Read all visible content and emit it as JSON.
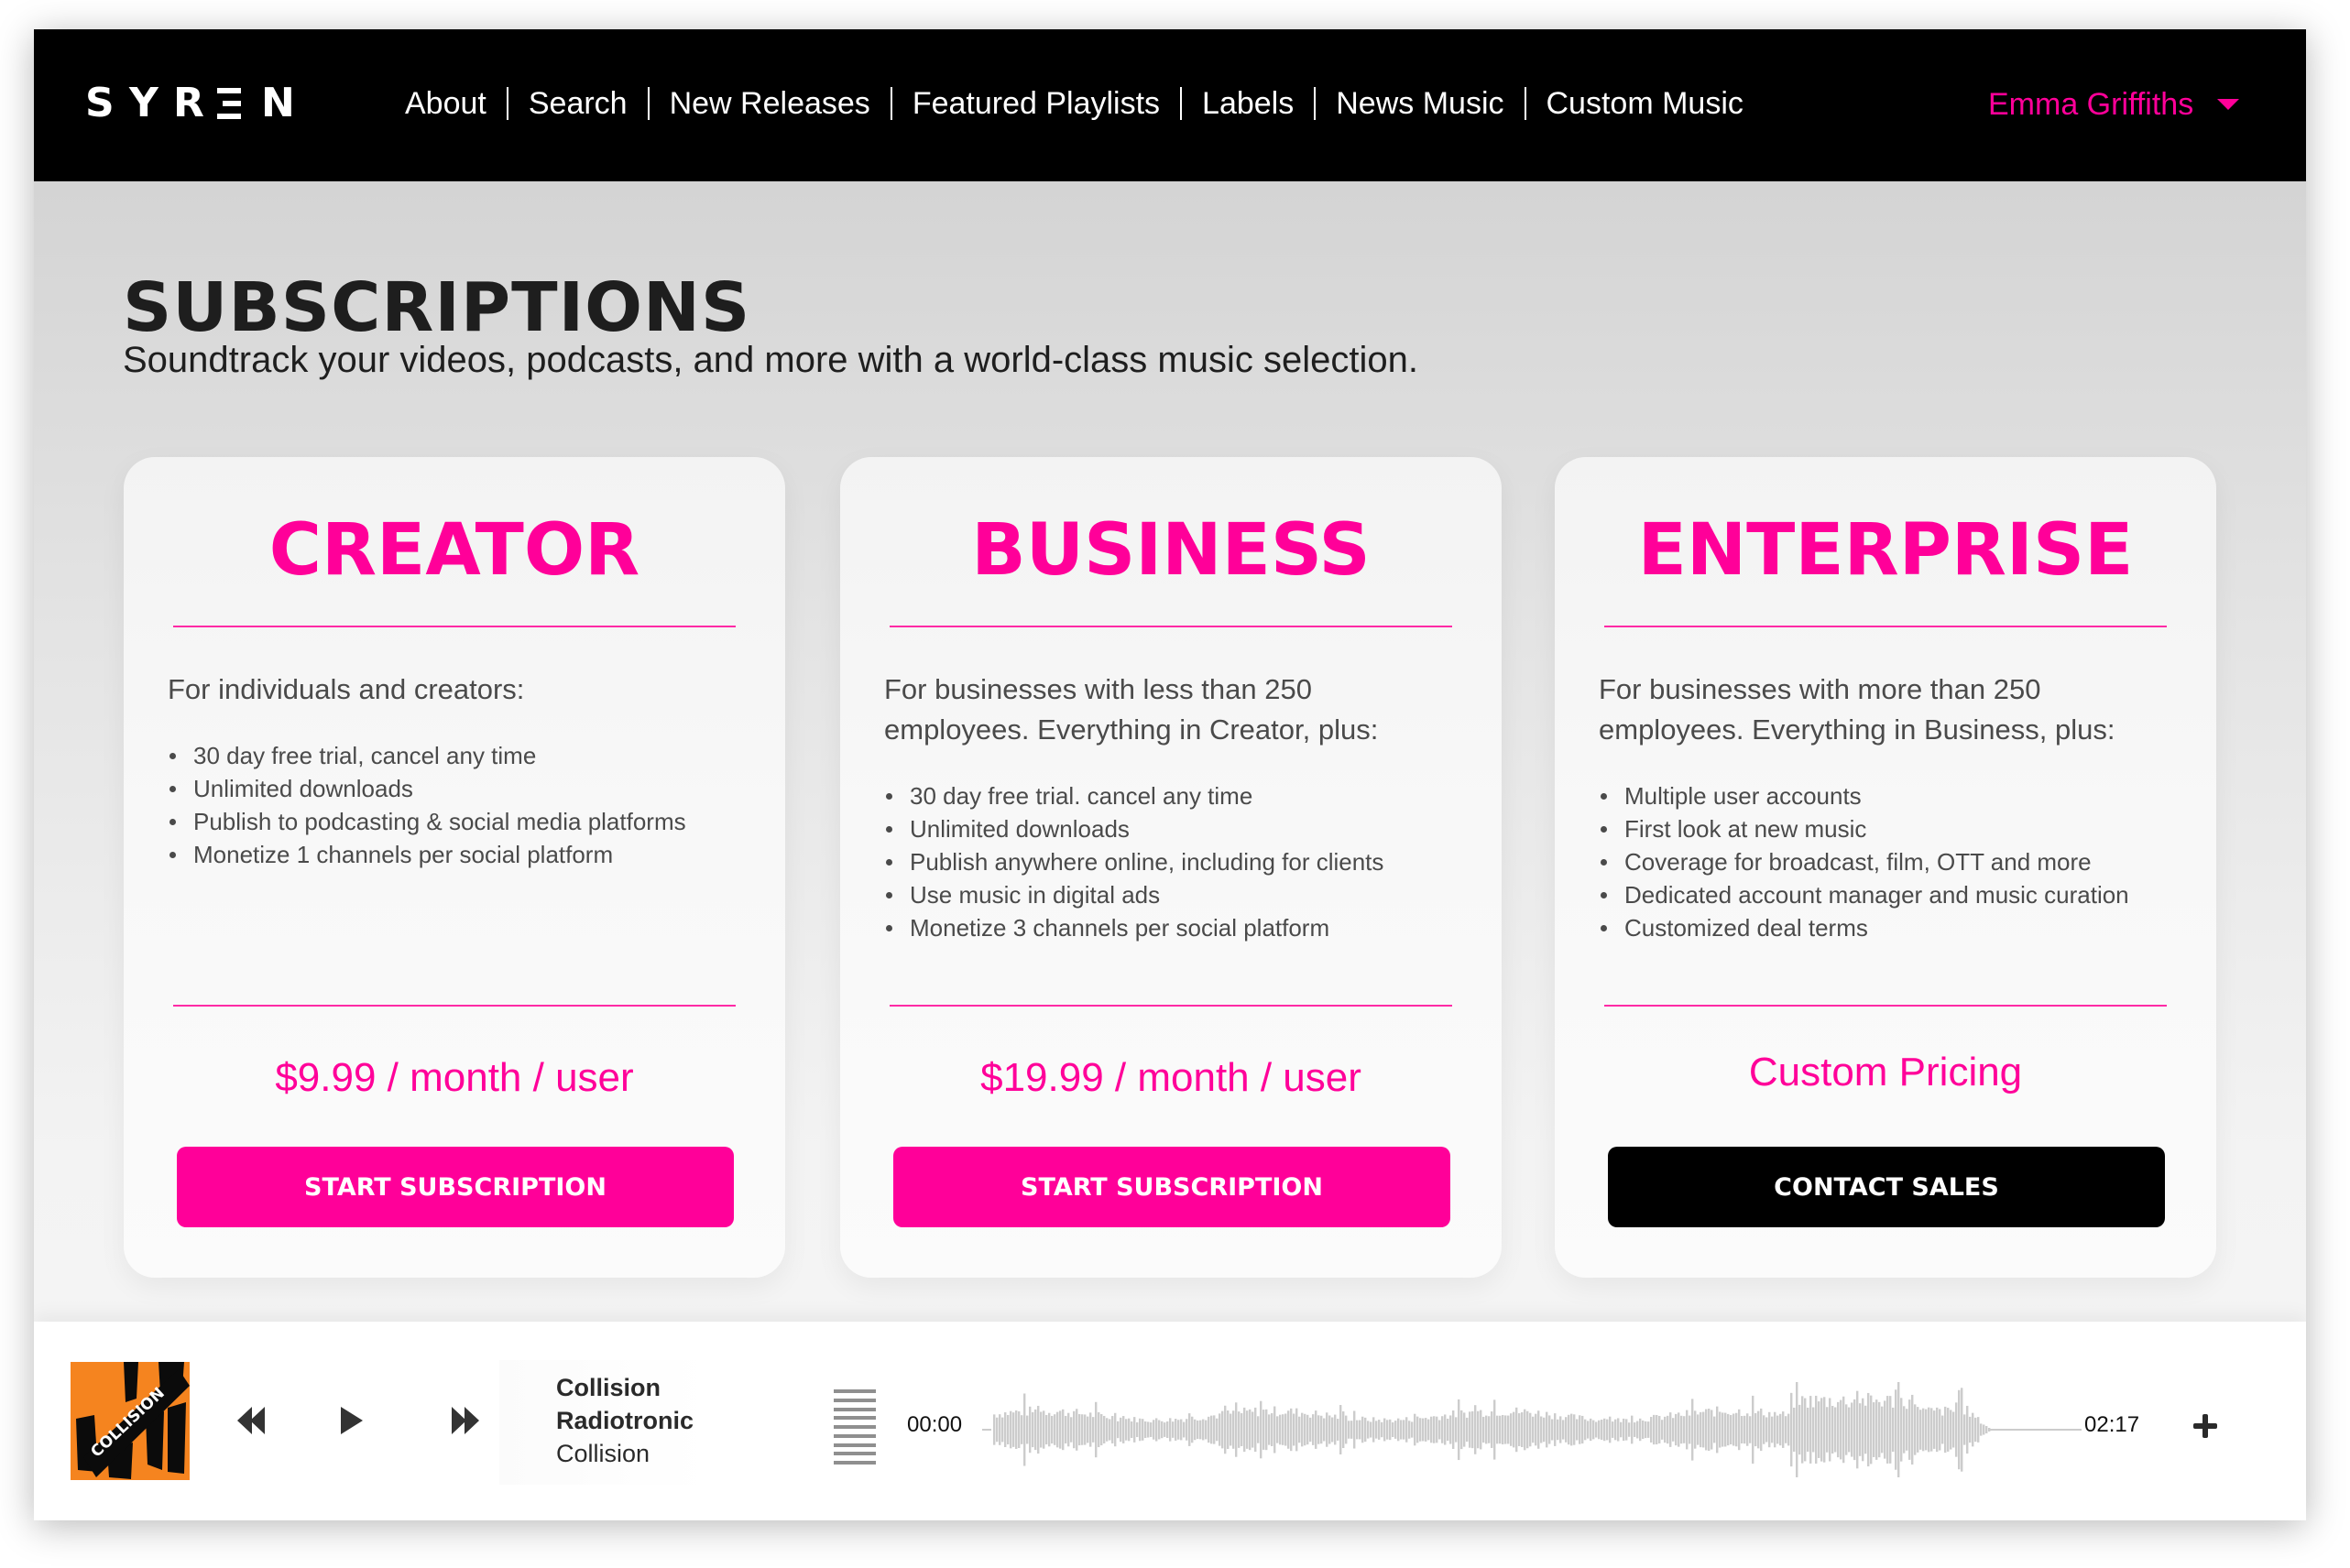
{
  "colors": {
    "accent": "#ff0099",
    "header_bg": "#000000",
    "text_dark": "#1e1e1e",
    "text_body": "#4a4a4a",
    "album_orange": "#f5841f",
    "waveform": "#cccccc"
  },
  "header": {
    "logo": [
      "S",
      "Y",
      "R",
      "E",
      "N"
    ],
    "logo_text": "SYREN",
    "nav": [
      {
        "label": "About"
      },
      {
        "label": "Search"
      },
      {
        "label": "New Releases"
      },
      {
        "label": "Featured Playlists"
      },
      {
        "label": "Labels"
      },
      {
        "label": "News Music"
      },
      {
        "label": "Custom Music"
      }
    ],
    "user": {
      "name": "Emma Griffiths",
      "icon": "caret-down-icon"
    }
  },
  "main": {
    "title": "SUBSCRIPTIONS",
    "subtitle": "Soundtrack your videos, podcasts, and more with a world-class music selection.",
    "plans": [
      {
        "name": "CREATOR",
        "intro": "For individuals and creators:",
        "features": [
          "30 day free trial, cancel any time",
          "Unlimited downloads",
          "Publish to podcasting & social media platforms",
          "Monetize 1 channels per social platform"
        ],
        "price": "$9.99 / month / user",
        "button": "START SUBSCRIPTION"
      },
      {
        "name": "BUSINESS",
        "intro": "For businesses with less than 250 employees. Everything in Creator, plus:",
        "features": [
          "30 day free trial. cancel any time",
          "Unlimited downloads",
          "Publish anywhere online, including for clients",
          "Use music in digital ads",
          "Monetize 3 channels per social platform"
        ],
        "price": "$19.99 / month / user",
        "button": "START SUBSCRIPTION"
      },
      {
        "name": "ENTERPRISE",
        "intro": "For businesses with more than 250 employees. Everything in Business, plus:",
        "features": [
          "Multiple user accounts",
          "First look at new music",
          "Coverage for broadcast, film, OTT and more",
          "Dedicated account manager and music curation",
          "Customized deal terms"
        ],
        "price": "Custom Pricing",
        "button": "CONTACT SALES"
      }
    ]
  },
  "player": {
    "album_art_text": "COLLISION",
    "track": {
      "title": "Collision",
      "artist": "Radiotronic",
      "album": "Collision"
    },
    "time_current": "00:00",
    "time_total": "02:17",
    "progress": 0,
    "icons": {
      "previous": "rewind-icon",
      "play": "play-icon",
      "next": "fast-forward-icon",
      "queue": "queue-list-icon",
      "add": "plus-icon"
    }
  }
}
